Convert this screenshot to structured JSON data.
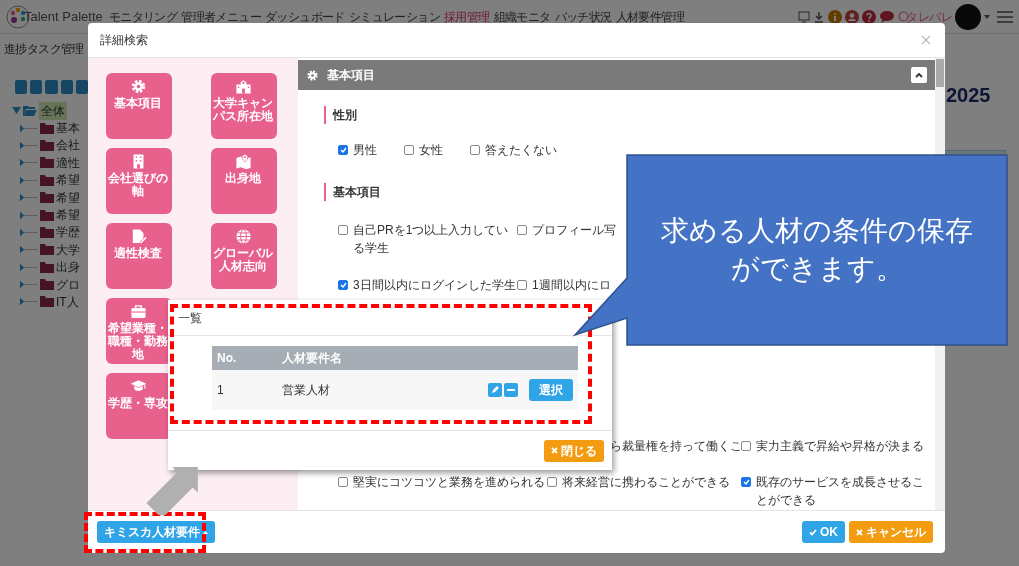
{
  "app": {
    "logo": "Talent Palette",
    "nav": [
      {
        "label": "モニタリング",
        "selected": false
      },
      {
        "label": "管理者メニュー",
        "selected": false
      },
      {
        "label": "ダッシュボード",
        "selected": false
      },
      {
        "label": "シミュレーション",
        "selected": false
      },
      {
        "label": "採用管理",
        "selected": true
      },
      {
        "label": "組織モニタ",
        "selected": false
      },
      {
        "label": "バッチ状況",
        "selected": false
      },
      {
        "label": "人材要件管理",
        "selected": false
      }
    ],
    "user": "タレパレ",
    "subbar": "進捗タスク管理",
    "tree": {
      "root": "全体",
      "children": [
        {
          "label": "基本"
        },
        {
          "label": "会社"
        },
        {
          "label": "適性"
        },
        {
          "label": "希望"
        },
        {
          "label": "希望"
        },
        {
          "label": "希望"
        },
        {
          "label": "学歴"
        },
        {
          "label": "大学"
        },
        {
          "label": "出身"
        },
        {
          "label": "グロ"
        },
        {
          "label": "IT人"
        }
      ]
    },
    "heading": "2025"
  },
  "modal": {
    "title": "詳細検索",
    "categories": [
      {
        "label": "基本項目"
      },
      {
        "label": "大学キャンパス所在地"
      },
      {
        "label": "会社選びの軸"
      },
      {
        "label": "出身地"
      },
      {
        "label": "適性検査"
      },
      {
        "label": "グローバル人材志向"
      },
      {
        "label": "希望業種・職種・勤務地"
      },
      {
        "label": "学歴・専攻"
      }
    ],
    "section": {
      "title": "基本項目",
      "expanded": true,
      "groups": [
        {
          "title": "性別",
          "options": [
            {
              "label": "男性",
              "checked": true
            },
            {
              "label": "女性",
              "checked": false
            },
            {
              "label": "答えたくない",
              "checked": false
            }
          ]
        },
        {
          "title": "基本項目",
          "options": [
            {
              "label": "自己PRを1つ以上入力している学生",
              "checked": false
            },
            {
              "label": "プロフィール写",
              "checked": false
            },
            {
              "label": "3日間以内にログインした学生",
              "checked": true
            },
            {
              "label": "1週間以内にロ",
              "checked": false
            }
          ]
        }
      ],
      "more_options": [
        {
          "kind": "text",
          "label": "ら裁量権を持って働くこ"
        },
        {
          "kind": "checkbox",
          "label": "実力主義で昇給や昇格が決まる",
          "checked": false
        },
        {
          "kind": "checkbox",
          "label": "堅実にコツコツと業務を進められる",
          "checked": false
        },
        {
          "kind": "checkbox",
          "label": "将来経営に携わることができる",
          "checked": false
        },
        {
          "kind": "checkbox",
          "label": "既存のサービスを成長させることができる",
          "checked": true
        }
      ]
    },
    "footer": {
      "dropdown": "キミスカ人材要件",
      "ok": "OK",
      "cancel": "キャンセル"
    }
  },
  "list_popup": {
    "title": "一覧",
    "columns": [
      "No.",
      "人材要件名"
    ],
    "rows": [
      {
        "no": "1",
        "name": "営業人材",
        "action": "選択"
      }
    ],
    "close": "閉じる"
  },
  "callout": {
    "text": "求める人材の条件の保存ができます。"
  }
}
